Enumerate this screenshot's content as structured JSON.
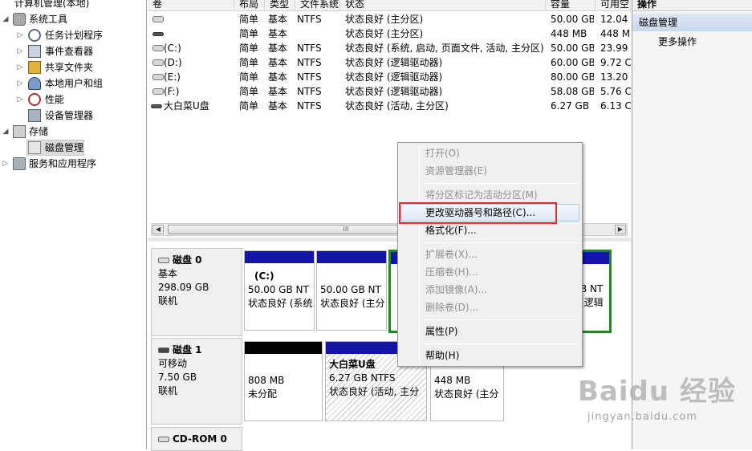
{
  "tree": {
    "root": "计算机管理(本地)",
    "system_tools": "系统工具",
    "task_scheduler": "任务计划程序",
    "event_viewer": "事件查看器",
    "shared_folders": "共享文件夹",
    "local_users": "本地用户和组",
    "performance": "性能",
    "device_manager": "设备管理器",
    "storage": "存储",
    "disk_management": "磁盘管理",
    "services_apps": "服务和应用程序"
  },
  "volume_list": {
    "headers": [
      "卷",
      "布局",
      "类型",
      "文件系统",
      "状态",
      "容量",
      "可用空"
    ],
    "rows": [
      {
        "vol": "",
        "layout": "简单",
        "type": "基本",
        "fs": "NTFS",
        "status": "状态良好 (主分区)",
        "cap": "50.00 GB",
        "free": "12.04"
      },
      {
        "vol": "",
        "layout": "简单",
        "type": "基本",
        "fs": "",
        "status": "状态良好 (主分区)",
        "cap": "448 MB",
        "free": "448 M"
      },
      {
        "vol": "(C:)",
        "layout": "简单",
        "type": "基本",
        "fs": "NTFS",
        "status": "状态良好 (系统, 启动, 页面文件, 活动, 主分区)",
        "cap": "50.00 GB",
        "free": "23.99"
      },
      {
        "vol": "(D:)",
        "layout": "简单",
        "type": "基本",
        "fs": "NTFS",
        "status": "状态良好 (逻辑驱动器)",
        "cap": "60.00 GB",
        "free": "9.72 C"
      },
      {
        "vol": "(E:)",
        "layout": "简单",
        "type": "基本",
        "fs": "NTFS",
        "status": "状态良好 (逻辑驱动器)",
        "cap": "80.00 GB",
        "free": "13.20"
      },
      {
        "vol": "(F:)",
        "layout": "简单",
        "type": "基本",
        "fs": "NTFS",
        "status": "状态良好 (逻辑驱动器)",
        "cap": "58.08 GB",
        "free": "5.76 C"
      },
      {
        "vol": "大白菜U盘",
        "layout": "简单",
        "type": "基本",
        "fs": "NTFS",
        "status": "状态良好 (活动, 主分区)",
        "cap": "6.27 GB",
        "free": "6.13 C"
      }
    ],
    "scroll_thumb": "III"
  },
  "disks": {
    "disk0": {
      "name": "磁盘 0",
      "type": "基本",
      "size": "298.09 GB",
      "state": "联机",
      "p1": {
        "title": "(C:)",
        "line1": "50.00 GB NT",
        "line2": "状态良好 (系统"
      },
      "p2": {
        "line1": "50.00 GB NT",
        "line2": "状态良好 (主分"
      },
      "p3": {
        "line1": "B NT",
        "line2": "(逻辑"
      }
    },
    "disk1": {
      "name": "磁盘 1",
      "type": "可移动",
      "size": "7.50 GB",
      "state": "联机",
      "p1": {
        "line1": "808 MB",
        "line2": "未分配"
      },
      "p2": {
        "title": "大白菜U盘",
        "line1": "6.27 GB NTFS",
        "line2": "状态良好 (活动, 主分"
      },
      "p3": {
        "line1": "448 MB",
        "line2": "状态良好 (主分"
      }
    },
    "cdrom": {
      "name": "CD-ROM 0"
    }
  },
  "actions": {
    "header": "操作",
    "section": "磁盘管理",
    "more": "更多操作"
  },
  "context_menu": {
    "open": "打开(O)",
    "explorer": "资源管理器(E)",
    "mark_active": "将分区标记为活动分区(M)",
    "change_letter": "更改驱动器号和路径(C)...",
    "format": "格式化(F)...",
    "extend": "扩展卷(X)...",
    "shrink": "压缩卷(H)...",
    "mirror": "添加镜像(A)...",
    "delete": "删除卷(D)...",
    "properties": "属性(P)",
    "help": "帮助(H)"
  },
  "watermark": {
    "brand": "Baidu 经验",
    "sub": "jingyan.baidu.com"
  }
}
